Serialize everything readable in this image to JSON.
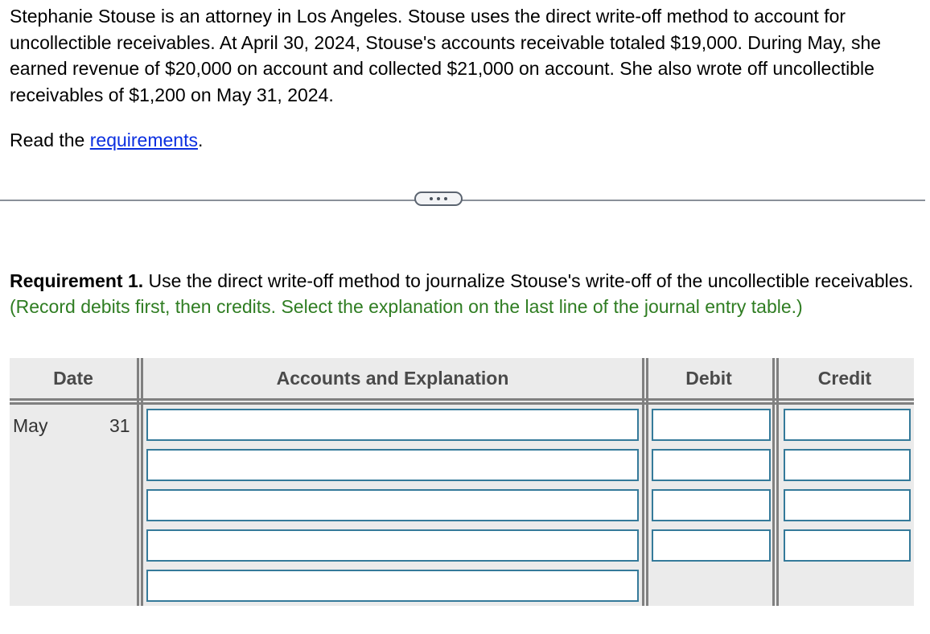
{
  "problem": {
    "text": "Stephanie Stouse is an attorney in Los Angeles. Stouse uses the direct write-off method to account for uncollectible receivables. At April 30, 2024, Stouse's accounts receivable totaled $19,000. During May, she earned revenue of $20,000 on account and collected $21,000 on account. She also wrote off uncollectible receivables of $1,200 on May 31, 2024."
  },
  "read_requirements": {
    "prefix": "Read the ",
    "link": "requirements",
    "suffix": "."
  },
  "divider": {
    "icon": "ellipsis-icon"
  },
  "requirement": {
    "label": "Requirement 1.",
    "text": " Use the direct write-off method to journalize Stouse's write-off of the uncollectible receivables. ",
    "hint": "(Record debits first, then credits. Select the explanation on the last line of the journal entry table.)",
    "hint_color": "#2f7d22"
  },
  "journal": {
    "headers": {
      "date": "Date",
      "accounts": "Accounts and Explanation",
      "debit": "Debit",
      "credit": "Credit"
    },
    "date_month": "May",
    "date_day": "31",
    "rows": [
      {
        "account": "",
        "debit": "",
        "credit": ""
      },
      {
        "account": "",
        "debit": "",
        "credit": ""
      },
      {
        "account": "",
        "debit": "",
        "credit": ""
      },
      {
        "account": "",
        "debit": "",
        "credit": ""
      },
      {
        "account": ""
      }
    ],
    "input_border_color": "#357a9a"
  }
}
